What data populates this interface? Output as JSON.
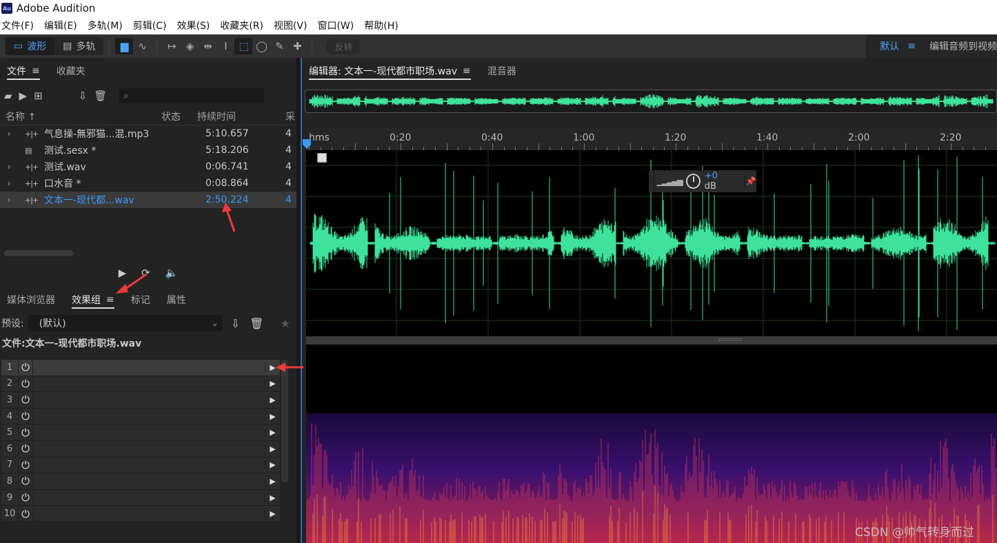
{
  "app": {
    "title": "Adobe Audition",
    "logo": "Au"
  },
  "menu": [
    "文件(F)",
    "编辑(E)",
    "多轨(M)",
    "剪辑(C)",
    "效果(S)",
    "收藏夹(R)",
    "视图(V)",
    "窗口(W)",
    "帮助(H)"
  ],
  "toolbar": {
    "waveform_label": "波形",
    "multitrack_label": "多轨",
    "invert_label": "反转",
    "workspace_label": "默认",
    "workspace2_label": "编辑音频到视频"
  },
  "files_panel": {
    "tabs": [
      "文件",
      "收藏夹"
    ],
    "search_placeholder": "",
    "columns": {
      "name": "名称 ↑",
      "status": "状态",
      "duration": "持续时间",
      "rate": "采"
    },
    "rows": [
      {
        "expand": "›",
        "icon": "waveform-icon",
        "name": "气息操-無邪猫...混.mp3",
        "duration": "5:10.657",
        "rate": "4"
      },
      {
        "expand": "",
        "icon": "multitrack-icon",
        "name": "测试.sesx *",
        "duration": "5:18.206",
        "rate": "4"
      },
      {
        "expand": "›",
        "icon": "waveform-icon",
        "name": "测试.wav",
        "duration": "0:06.741",
        "rate": "4"
      },
      {
        "expand": "›",
        "icon": "waveform-icon",
        "name": "口水音 *",
        "duration": "0:08.864",
        "rate": "4"
      },
      {
        "expand": "›",
        "icon": "waveform-icon",
        "name": "文本一-现代都...wav",
        "duration": "2:50.224",
        "rate": "4"
      }
    ],
    "selected_index": 4
  },
  "lower_panel": {
    "tabs": [
      "媒体浏览器",
      "效果组",
      "标记",
      "属性"
    ],
    "active_tab": 1,
    "preset_label": "预设:",
    "preset_value": "(默认)",
    "file_label": "文件:文本一-现代都市职场.wav",
    "rack_slots": [
      "1",
      "2",
      "3",
      "4",
      "5",
      "6",
      "7",
      "8",
      "9",
      "10"
    ]
  },
  "editor": {
    "tab_label": "编辑器: 文本一-现代都市职场.wav",
    "mixer_label": "混音器",
    "timeline_unit": "hms",
    "ticks": [
      "0:20",
      "0:40",
      "1:00",
      "1:20",
      "1:40",
      "2:00",
      "2:20"
    ],
    "hud_gain": "+0",
    "hud_unit": " dB"
  },
  "colors": {
    "accent": "#3d98f5",
    "waveform": "#3ee29b",
    "annotation_arrow": "#f03a3a"
  },
  "watermark": "CSDN @帅气转身而过"
}
